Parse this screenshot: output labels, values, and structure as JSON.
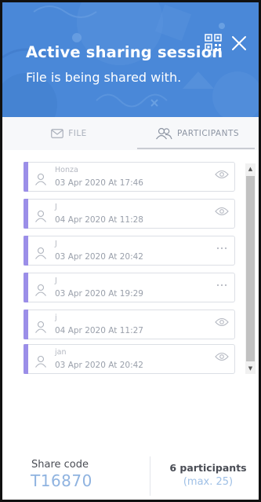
{
  "header": {
    "title": "Active sharing session",
    "subtitle": "File is being shared with.",
    "background_color": "#4a88d8",
    "qr_icon": "qr-code-icon",
    "close_icon": "close-icon"
  },
  "tabs": [
    {
      "label": "FILE",
      "icon": "envelope-icon",
      "active": false
    },
    {
      "label": "PARTICIPANTS",
      "icon": "people-icon",
      "active": true
    }
  ],
  "participants": [
    {
      "name": "Honza",
      "date": "03 Apr 2020 At 17:46",
      "action_icon": "eye-icon"
    },
    {
      "name": "J",
      "date": "04 Apr 2020 At 11:28",
      "action_icon": "eye-icon"
    },
    {
      "name": "J",
      "date": "03 Apr 2020 At 20:42",
      "action_icon": "more-icon"
    },
    {
      "name": "J",
      "date": "03 Apr 2020 At 19:29",
      "action_icon": "more-icon"
    },
    {
      "name": "j",
      "date": "04 Apr 2020 At 11:27",
      "action_icon": "eye-icon"
    },
    {
      "name": "jan",
      "date": "03 Apr 2020 At 20:42",
      "action_icon": "eye-icon"
    }
  ],
  "accent_color": "#9b8ee8",
  "footer": {
    "share_code_label": "Share code",
    "share_code": "T16870",
    "participants_count": "6 participants",
    "participants_max": "(max. 25)"
  }
}
